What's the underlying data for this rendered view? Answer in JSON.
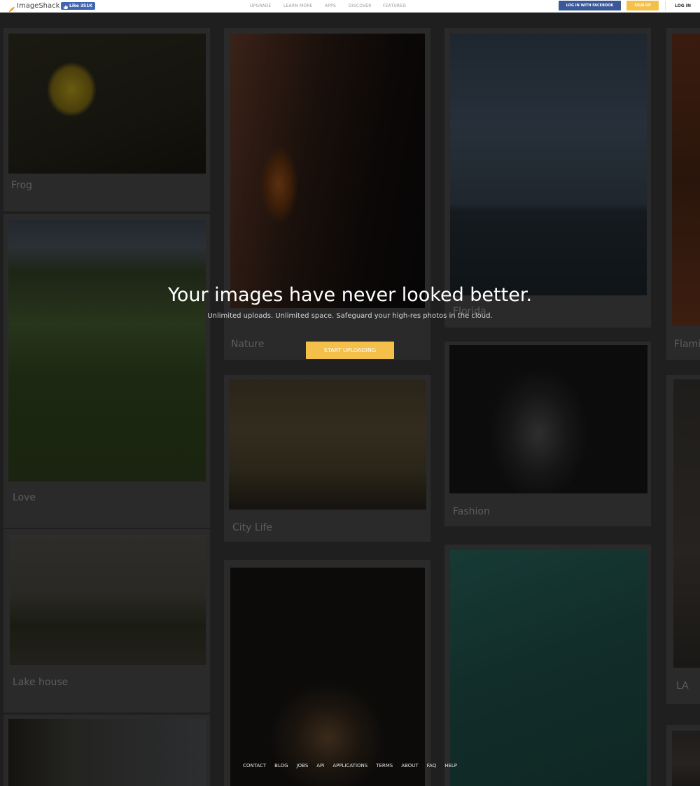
{
  "header": {
    "logo_text": "ImageShack",
    "fb_like_label": "Like 351K",
    "nav": [
      "UPGRADE",
      "LEARN MORE",
      "APPS",
      "DISCOVER",
      "FEATURED"
    ],
    "fb_login_label": "LOG IN WITH FACEBOOK",
    "signup_label": "SIGN UP",
    "login_label": "LOG IN"
  },
  "hero": {
    "title": "Your images have never looked better.",
    "subtitle": "Unlimited uploads. Unlimited space. Safeguard your high-res photos in the cloud.",
    "cta_label": "START UPLOADING"
  },
  "gallery": {
    "captions": [
      "Frog",
      "Love",
      "Lake house",
      "Nature",
      "City Life",
      "Florida",
      "Fashion",
      "Flami",
      "LA"
    ]
  },
  "footer": {
    "links": [
      "CONTACT",
      "BLOG",
      "JOBS",
      "API",
      "APPLICATIONS",
      "TERMS",
      "ABOUT",
      "FAQ",
      "HELP"
    ]
  },
  "colors": {
    "accent_yellow": "#f4c04a",
    "facebook_blue": "#3b5998",
    "page_overlay": "#1f1f1f"
  }
}
